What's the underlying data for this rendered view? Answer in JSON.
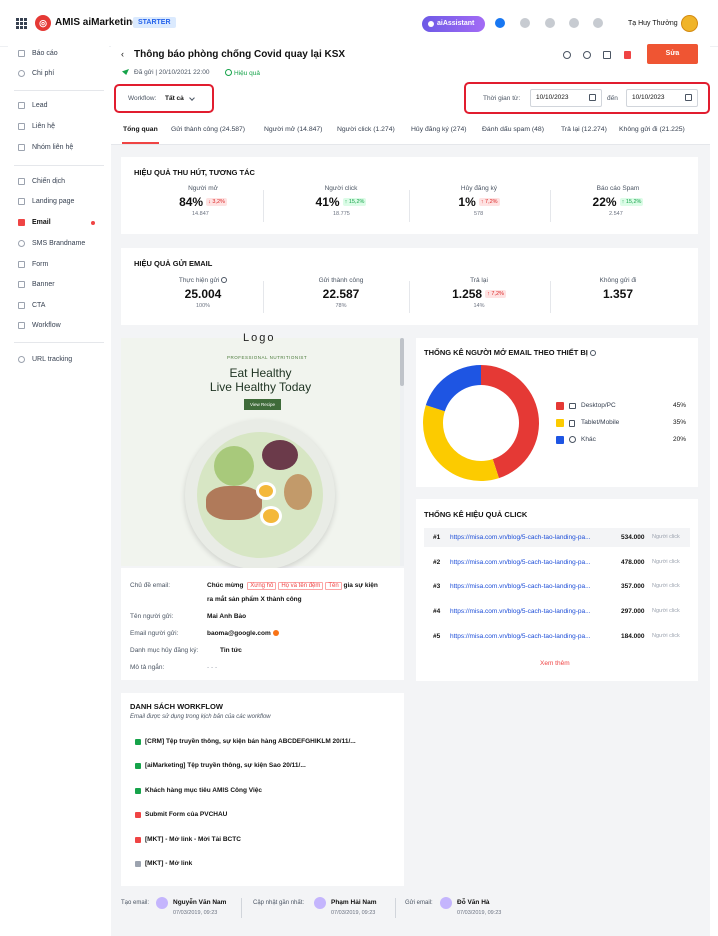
{
  "app": {
    "brand": "AMIS aiMarketing",
    "plan": "STARTER",
    "ai_label": "aiAssistant",
    "user": "Tạ Huy Thưởng"
  },
  "sidebar": {
    "items": [
      {
        "label": "Báo cáo"
      },
      {
        "label": "Chi phí"
      },
      {
        "label": "Lead"
      },
      {
        "label": "Liên hệ"
      },
      {
        "label": "Nhóm liên hệ"
      },
      {
        "label": "Chiến dịch"
      },
      {
        "label": "Landing page"
      },
      {
        "label": "Email"
      },
      {
        "label": "SMS Brandname"
      },
      {
        "label": "Form"
      },
      {
        "label": "Banner"
      },
      {
        "label": "CTA"
      },
      {
        "label": "Workflow"
      },
      {
        "label": "URL tracking"
      }
    ]
  },
  "header": {
    "title": "Thông báo phòng chống Covid quay lại KSX",
    "sent": "Đã gửi | 20/10/2021  22:00",
    "status": "Hiệu quả",
    "edit": "Sửa"
  },
  "filters": {
    "workflow_label": "Workflow:",
    "workflow_value": "Tất cả",
    "time_label": "Thời gian từ:",
    "from": "10/10/2023",
    "to_label": "đến",
    "to": "10/10/2023"
  },
  "tabs": [
    "Tổng quan",
    "Gửi thành công (24.587)",
    "Người mở (14.847)",
    "Người click (1.274)",
    "Hủy đăng ký (274)",
    "Đánh dấu spam (48)",
    "Trả lại (12.274)",
    "Không gửi đi (21.225)"
  ],
  "engagement": {
    "title": "HIỆU QUẢ THU HÚT, TƯƠNG TÁC",
    "kpis": [
      {
        "label": "Người mở",
        "value": "84%",
        "change": "↓ 3,2%",
        "dir": "dn",
        "sub": "14.847"
      },
      {
        "label": "Người click",
        "value": "41%",
        "change": "↑ 15,2%",
        "dir": "up",
        "sub": "18.775"
      },
      {
        "label": "Hủy đăng ký",
        "value": "1%",
        "change": "↑ 7,2%",
        "dir": "dn",
        "sub": "578"
      },
      {
        "label": "Báo cáo Spam",
        "value": "22%",
        "change": "↑ 15,2%",
        "dir": "up",
        "sub": "2.547"
      }
    ]
  },
  "sending": {
    "title": "HIỆU QUẢ GỬI EMAIL",
    "kpis": [
      {
        "label": "Thực hiện gửi",
        "value": "25.004",
        "change": "",
        "sub": "100%"
      },
      {
        "label": "Gửi thành công",
        "value": "22.587",
        "change": "",
        "sub": "78%"
      },
      {
        "label": "Trả lại",
        "value": "1.258",
        "change": "↑ 7,2%",
        "dir": "dn",
        "sub": "14%"
      },
      {
        "label": "Không gửi đi",
        "value": "1.357",
        "change": "",
        "sub": ""
      }
    ]
  },
  "preview": {
    "logo": "Logo",
    "subtitle": "PROFESSIONAL NUTRITIONIST",
    "h1a": "Eat Healthy",
    "h1b": "Live Healthy Today",
    "button": "View Recipe"
  },
  "info": {
    "subject_label": "Chủ đề email:",
    "subject_a": "Chúc mừng",
    "tag1": "Xưng hô",
    "tag2": "Họ và tên đệm",
    "tag3": "Tên",
    "subject_b": "gia sự kiện",
    "subject_c": "ra mắt sản phẩm X thành công",
    "sender_label": "Tên người gửi:",
    "sender": "Mai Anh Bảo",
    "email_label": "Email người gửi:",
    "email": "baoma@google.com",
    "unsub_label": "Danh mục hủy đăng ký:",
    "unsub": "Tin tức",
    "desc_label": "Mô tả ngắn:",
    "desc": "- - -"
  },
  "device_chart": {
    "title": "THỐNG KÊ NGƯỜI MỞ EMAIL THEO THIẾT BỊ"
  },
  "chart_data": {
    "type": "pie",
    "title": "THỐNG KÊ NGƯỜI MỞ EMAIL THEO THIẾT BỊ",
    "categories": [
      "Desktop/PC",
      "Tablet/Mobile",
      "Khác"
    ],
    "values": [
      45,
      35,
      20
    ],
    "labels": [
      "45%",
      "35%",
      "20%"
    ],
    "colors": [
      "#e53935",
      "#fccb00",
      "#1e55e3"
    ],
    "legend": "right"
  },
  "clicks": {
    "title": "THỐNG KÊ HIỆU QUẢ CLICK",
    "unit": "Người click",
    "more": "Xem thêm",
    "rows": [
      {
        "rank": "#1",
        "url": "https://misa.com.vn/blog/5-cach-tao-landing-pa...",
        "count": "534.000"
      },
      {
        "rank": "#2",
        "url": "https://misa.com.vn/blog/5-cach-tao-landing-pa...",
        "count": "478.000"
      },
      {
        "rank": "#3",
        "url": "https://misa.com.vn/blog/5-cach-tao-landing-pa...",
        "count": "357.000"
      },
      {
        "rank": "#4",
        "url": "https://misa.com.vn/blog/5-cach-tao-landing-pa...",
        "count": "297.000"
      },
      {
        "rank": "#5",
        "url": "https://misa.com.vn/blog/5-cach-tao-landing-pa...",
        "count": "184.000"
      }
    ]
  },
  "workflows": {
    "title": "DANH SÁCH WORKFLOW",
    "subtitle": "Email được sử dụng trong kịch bản của các workflow",
    "items": [
      {
        "label": "[CRM] Tệp truyền thông, sự kiện bán hàng ABCDEFGHIKLM 20/11/...",
        "color": "#16a34a"
      },
      {
        "label": "[aiMarketing] Tệp truyền thông, sự kiện Sao  20/11/...",
        "color": "#16a34a"
      },
      {
        "label": "Khách hàng mục tiêu AMIS Công Việc",
        "color": "#16a34a"
      },
      {
        "label": "Submit Form của PVCHAU",
        "color": "#ef4444"
      },
      {
        "label": "[MKT] - Mở link - Mời Tải BCTC",
        "color": "#ef4444"
      },
      {
        "label": "[MKT] - Mở link",
        "color": "#9ca3af"
      }
    ]
  },
  "footer": [
    {
      "label": "Tạo email:",
      "name": "Nguyễn Văn Nam",
      "time": "07/03/2019, 09:23"
    },
    {
      "label": "Cập nhật gần nhất:",
      "name": "Phạm Hải Nam",
      "time": "07/03/2019, 09:23"
    },
    {
      "label": "Gửi email:",
      "name": "Đỗ Văn Hà",
      "time": "07/03/2019, 09:23"
    }
  ]
}
